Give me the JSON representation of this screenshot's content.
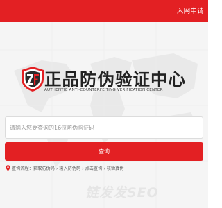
{
  "header": {
    "join_link": "入网申请",
    "accent_color": "#e32023"
  },
  "brand": {
    "logo_icon": "shield-zf-logo",
    "title": "正品防伪验证中心",
    "subtitle": "AUTHENTIC ANTI-COUNTERFEITING VERIFICATION CENTER"
  },
  "search": {
    "placeholder": "请输入您要查询的16位防伪验证码",
    "value": ""
  },
  "query_button": {
    "label": "查询"
  },
  "process": {
    "icon": "location-pin-icon",
    "text": "查询流程：获取防伪码 › 输入防伪码 › 点击查询 › 核验真伪"
  },
  "watermark": {
    "text": "链发发SEO"
  }
}
